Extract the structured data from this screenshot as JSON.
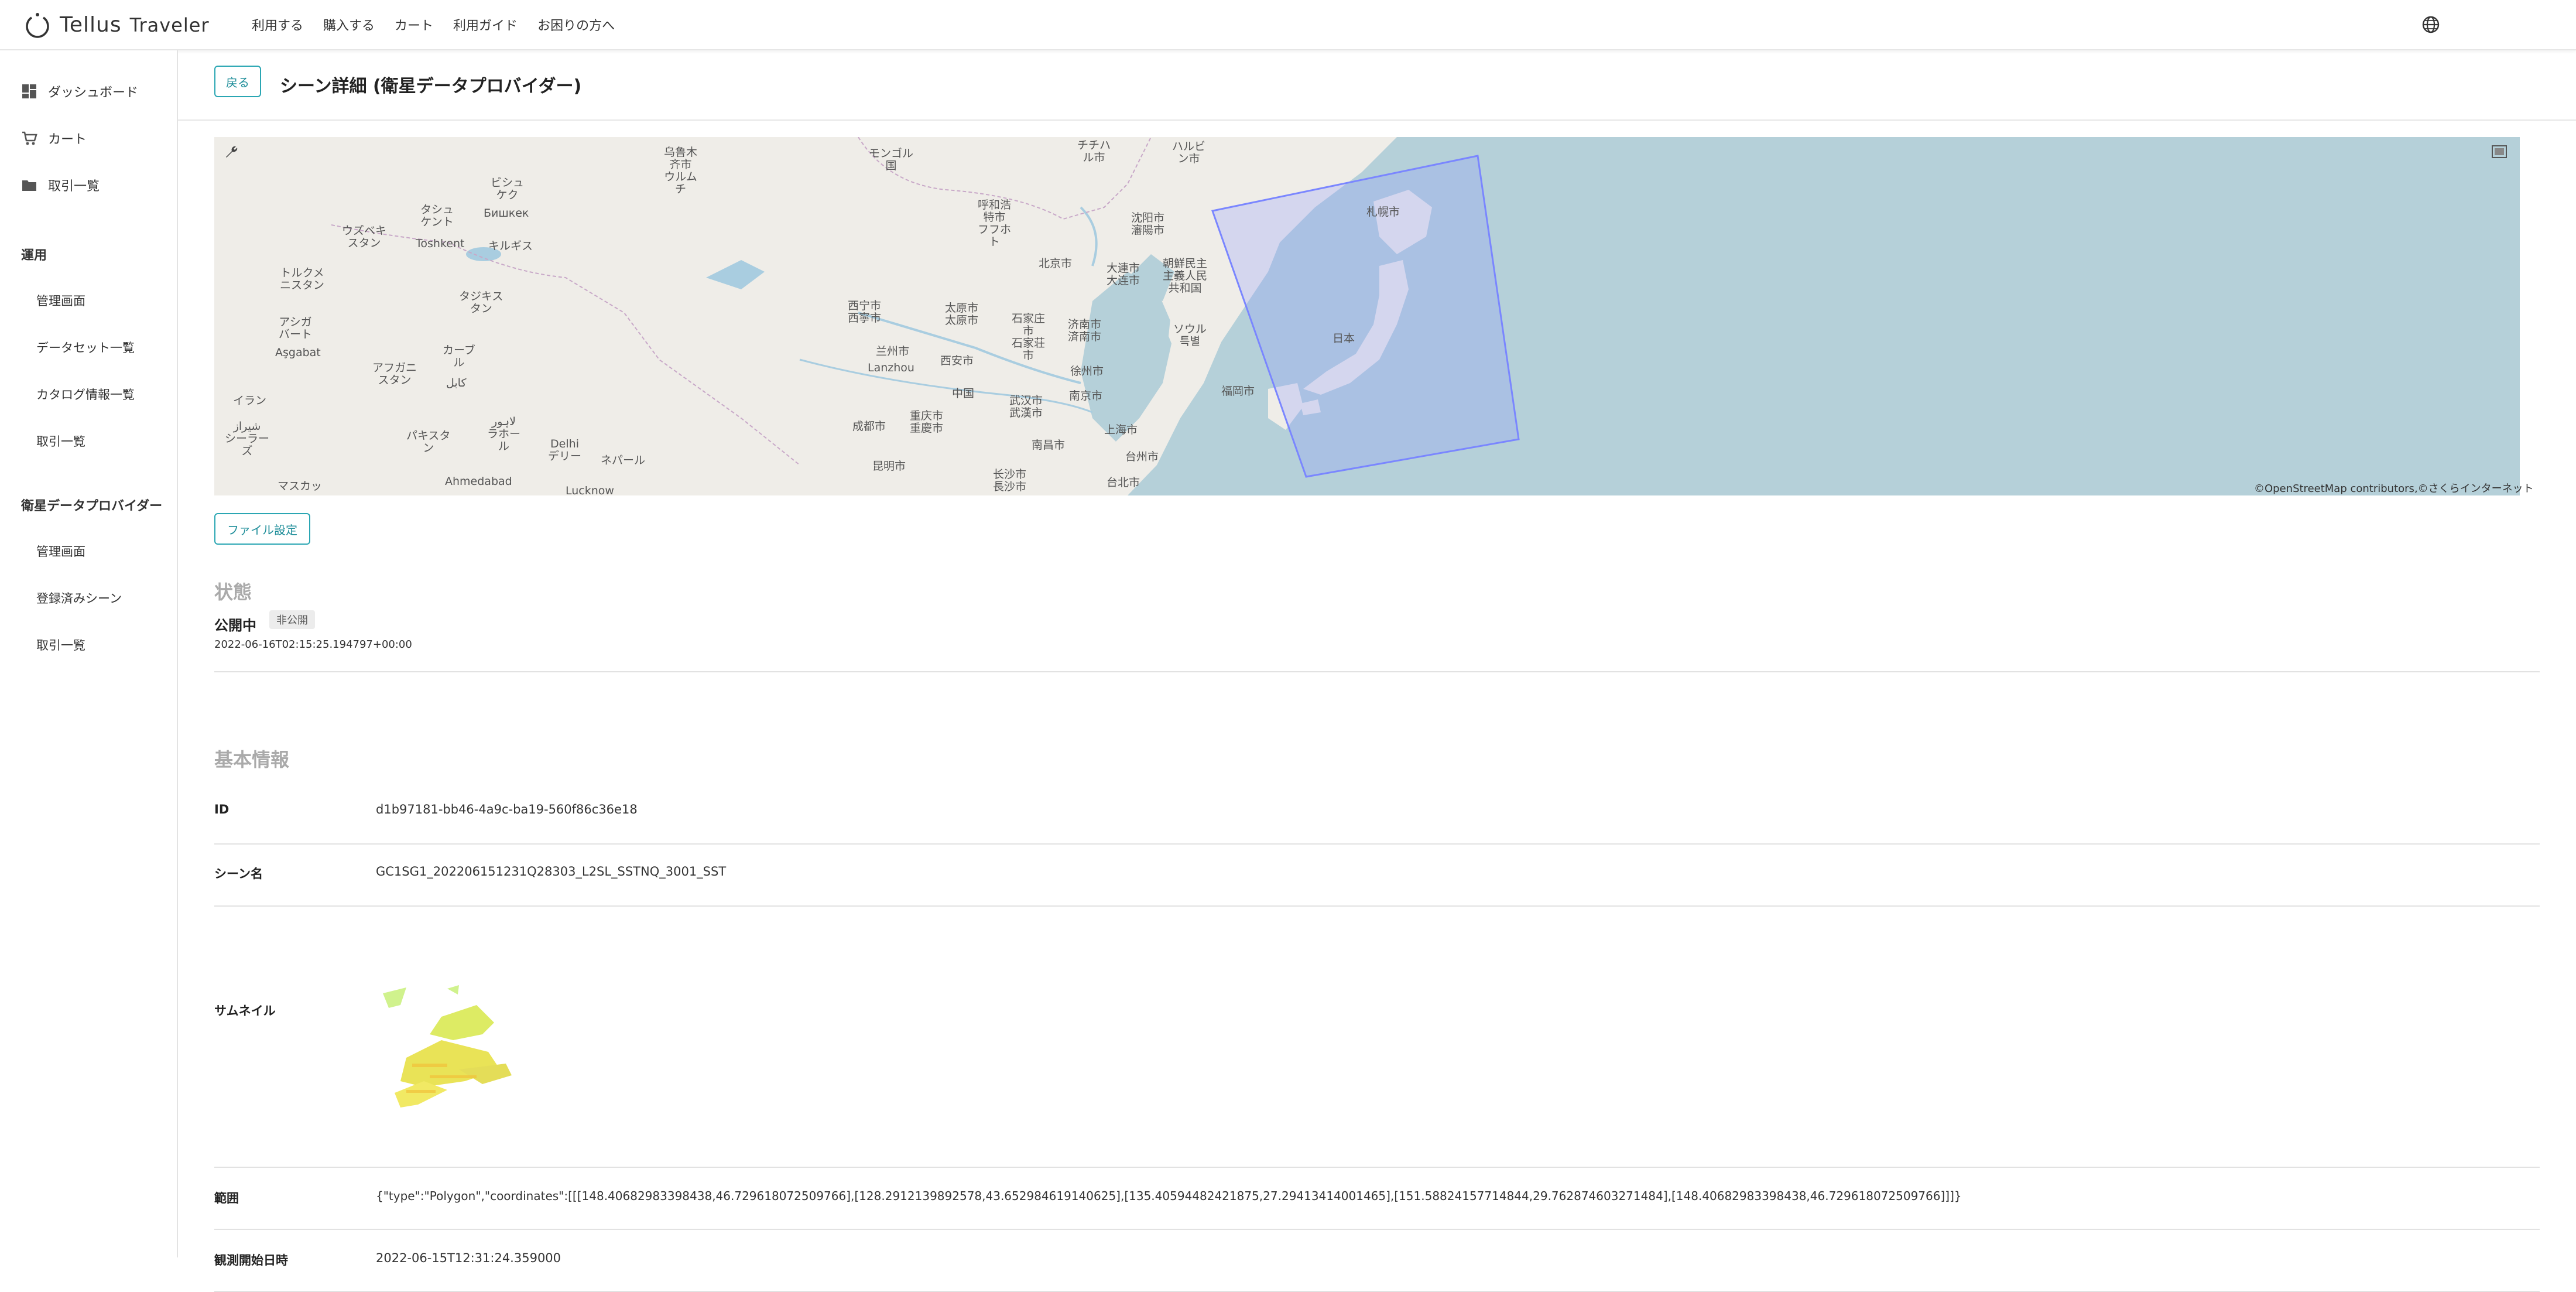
{
  "header": {
    "logo_text": "Tellus",
    "logo_sub": "Traveler",
    "nav": [
      "利用する",
      "購入する",
      "カート",
      "利用ガイド",
      "お困りの方へ"
    ],
    "globe_icon": "globe-icon"
  },
  "sidebar": {
    "items": [
      {
        "label": "ダッシュボード",
        "icon": "dashboard-icon"
      },
      {
        "label": "カート",
        "icon": "cart-icon"
      },
      {
        "label": "取引一覧",
        "icon": "folder-icon"
      }
    ],
    "section_operation": {
      "heading": "運用",
      "items": [
        "管理画面",
        "データセット一覧",
        "カタログ情報一覧",
        "取引一覧"
      ]
    },
    "section_provider": {
      "heading": "衛星データプロバイダー",
      "items": [
        "管理画面",
        "登録済みシーン",
        "取引一覧"
      ]
    }
  },
  "page": {
    "back_label": "戻る",
    "title": "シーン詳細 (衛星データプロバイダー)",
    "file_settings_label": "ファイル設定"
  },
  "map": {
    "attribution": "©OpenStreetMap contributors,©さくらインターネット",
    "labels": {
      "urumqi": "乌鲁木\n齐市\nウルム\nチ",
      "mongolia": "モンゴル\n国",
      "harbin": "ハルビ\nン市",
      "chichiha": "チチハ\nル市",
      "tashkent_jp": "タシュ\nケント",
      "tashkent": "Toshkent",
      "bishkek_jp": "ビシュ\nケク",
      "bishkek": "Бишкек",
      "uzbek": "ウズベキ\nスタン",
      "kyrgyz": "キルギス",
      "hohhot": "呼和浩\n特市\nフフホ\nト",
      "shenyang": "沈阳市\n瀋陽市",
      "sapporo": "札幌市",
      "turkmen": "トルクメ\nニスタン",
      "tajik": "タジキス\nタン",
      "beijing": "北京市",
      "dalian": "大連市\n大连市",
      "korea_n": "朝鮮民主\n主義人民\n共和国",
      "ashgabat_jp": "アシガ\nバート",
      "ashgabat": "Aşgabat",
      "xining": "西宁市\n西寧市",
      "taiyuan": "太原市\n太原市",
      "shijiazhuang": "石家庄\n市\n石家荘\n市",
      "jinan": "济南市\n済南市",
      "seoul": "ソウル\n특별",
      "japan": "日本",
      "kabul_jp": "カーブ\nル",
      "kabul": "کابل",
      "afghan": "アフガニ\nスタン",
      "lanzhou_jp": "兰州市",
      "lanzhou": "Lanzhou",
      "xian": "西安市",
      "xuzhou": "徐州市",
      "china": "中国",
      "nanjing": "南京市",
      "fukuoka": "福岡市",
      "iran": "イラン",
      "wuhan": "武汉市\n武漢市",
      "chengdu": "成都市",
      "chongqing": "重庆市\n重慶市",
      "shanghai": "上海市",
      "shiraz": "شیراز\nシーラー\nズ",
      "pakistan": "パキスタ\nン",
      "lahore": "لاہور\nラホー\nル",
      "delhi": "Delhi\nデリー",
      "nepal": "ネパール",
      "nanchang": "南昌市",
      "taizhou": "台州市",
      "kunming": "昆明市",
      "changsha": "长沙市\n長沙市",
      "muscat": "マスカッ",
      "ahmedabad": "Ahmedabad",
      "lucknow": "Lucknow",
      "taipei": "台北市"
    },
    "footprint_color": "#7a86ff"
  },
  "status": {
    "section_title": "状態",
    "current": "公開中",
    "badge": "非公開",
    "timestamp": "2022-06-16T02:15:25.194797+00:00"
  },
  "basic_info": {
    "section_title": "基本情報",
    "rows": [
      {
        "label": "ID",
        "value": "d1b97181-bb46-4a9c-ba19-560f86c36e18"
      },
      {
        "label": "シーン名",
        "value": "GC1SG1_202206151231Q28303_L2SL_SSTNQ_3001_SST"
      },
      {
        "label": "サムネイル",
        "value": ""
      },
      {
        "label": "範囲",
        "value": "{\"type\":\"Polygon\",\"coordinates\":[[[148.40682983398438,46.729618072509766],[128.2912139892578,43.652984619140625],[135.40594482421875,27.29413414001465],[151.58824157714844,29.762874603271484],[148.40682983398438,46.729618072509766]]]}"
      },
      {
        "label": "観測開始日時",
        "value": "2022-06-15T12:31:24.359000"
      }
    ]
  },
  "colors": {
    "accent": "#2aa6b3",
    "sea": "#b5d0d9",
    "land": "#efede8"
  }
}
